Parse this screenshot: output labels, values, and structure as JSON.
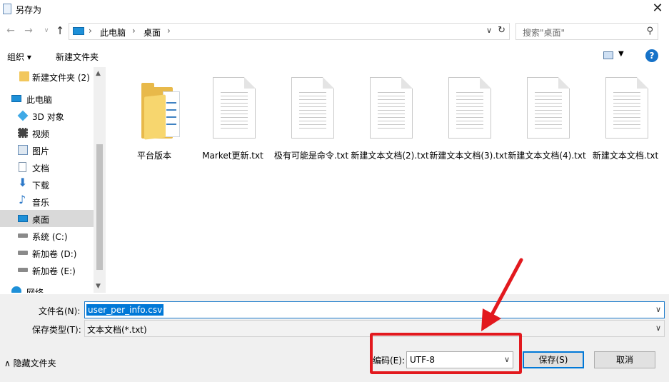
{
  "window": {
    "title": "另存为",
    "close_symbol": "✕"
  },
  "address": {
    "breadcrumbs": [
      "此电脑",
      "桌面"
    ],
    "separator": "›",
    "search_placeholder": "搜索\"桌面\""
  },
  "toolbar": {
    "organize": "组织 ▾",
    "new_folder": "新建文件夹"
  },
  "sidebar": {
    "items": [
      {
        "label": "新建文件夹 (2)",
        "icon": "folder-icon"
      },
      {
        "label": "此电脑",
        "icon": "pc-icon"
      },
      {
        "label": "3D 对象",
        "icon": "3d-objects-icon"
      },
      {
        "label": "视频",
        "icon": "video-icon"
      },
      {
        "label": "图片",
        "icon": "pictures-icon"
      },
      {
        "label": "文档",
        "icon": "documents-icon"
      },
      {
        "label": "下载",
        "icon": "download-icon"
      },
      {
        "label": "音乐",
        "icon": "music-icon"
      },
      {
        "label": "桌面",
        "icon": "desktop-icon",
        "selected": true
      },
      {
        "label": "系统 (C:)",
        "icon": "drive-icon"
      },
      {
        "label": "新加卷 (D:)",
        "icon": "drive-icon"
      },
      {
        "label": "新加卷 (E:)",
        "icon": "drive-icon"
      },
      {
        "label": "网络",
        "icon": "network-icon"
      }
    ]
  },
  "files": [
    {
      "name": "平台版本",
      "type": "folder"
    },
    {
      "name": "Market更新.txt",
      "type": "text"
    },
    {
      "name": "极有可能是命令.txt",
      "type": "text"
    },
    {
      "name": "新建文本文档(2).txt",
      "type": "text"
    },
    {
      "name": "新建文本文档(3).txt",
      "type": "text"
    },
    {
      "name": "新建文本文档(4).txt",
      "type": "text"
    },
    {
      "name": "新建文本文档.txt",
      "type": "text"
    }
  ],
  "form": {
    "filename_label": "文件名(N):",
    "filename_value": "user_per_info.csv",
    "filetype_label": "保存类型(T):",
    "filetype_value": "文本文档(*.txt)",
    "hide_folders": "隐藏文件夹",
    "encoding_label": "编码(E):",
    "encoding_value": "UTF-8",
    "save_label": "保存(S)",
    "cancel_label": "取消"
  },
  "annotation": {
    "color": "#e2191e"
  },
  "colors": {
    "accent": "#0078d7",
    "folder": "#e8b94a"
  }
}
